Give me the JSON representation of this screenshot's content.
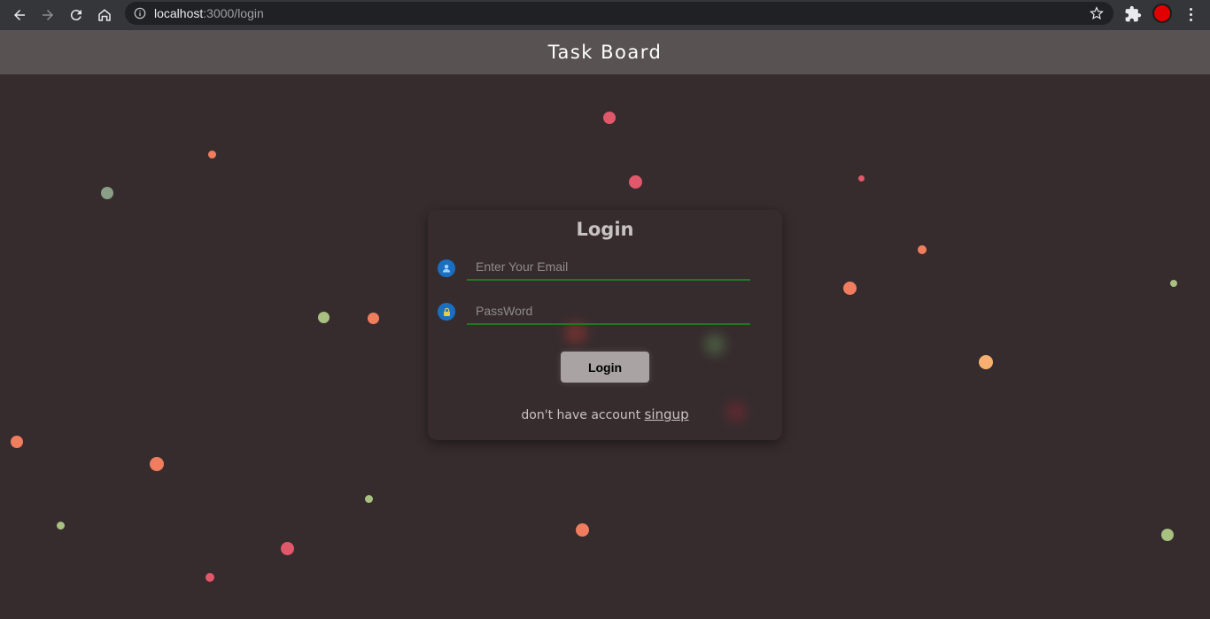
{
  "browser": {
    "url_host": "localhost",
    "url_path": ":3000/login"
  },
  "app": {
    "title": "Task Board"
  },
  "login": {
    "heading": "Login",
    "email_placeholder": "Enter Your Email",
    "password_placeholder": "PassWord",
    "button_label": "Login",
    "footer_text": "don't have account ",
    "signup_label": "singup"
  },
  "colors": {
    "background": "#362c2e",
    "header": "#585252",
    "input_underline": "#1f7a1f",
    "icon_blue": "#1a6fc2",
    "particle_red": "#e0586a",
    "particle_orange": "#f07e5e",
    "particle_green": "#a8c080",
    "particle_gray_green": "#8a9e88",
    "particle_peach": "#f8b070"
  },
  "icons": [
    "back-icon",
    "forward-icon",
    "reload-icon",
    "home-icon",
    "info-icon",
    "star-icon",
    "extensions-icon",
    "menu-icon",
    "user-icon",
    "lock-icon"
  ]
}
